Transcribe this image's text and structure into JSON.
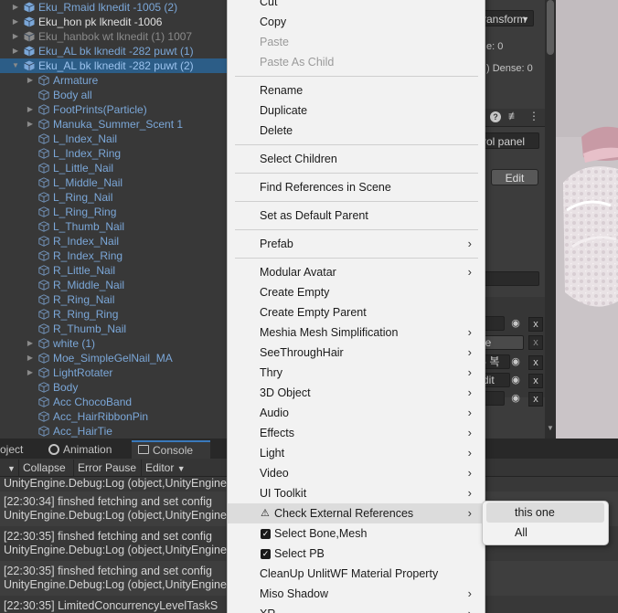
{
  "hierarchy": {
    "rows": [
      {
        "label": "Eku_Rmaid lknedit -1005 (2)",
        "type": "prefab",
        "depth": 0,
        "fold": "closed"
      },
      {
        "label": "Eku_hon pk lknedit -1006",
        "type": "white",
        "depth": 0,
        "fold": "closed"
      },
      {
        "label": "Eku_hanbok wt lknedit (1) 1007",
        "type": "faded",
        "depth": 0,
        "fold": "closed"
      },
      {
        "label": "Eku_AL bk  lknedit -282 puwt (1)",
        "type": "prefab",
        "depth": 0,
        "fold": "closed"
      },
      {
        "label": "Eku_AL bk  lknedit -282 puwt (2)",
        "type": "prefab",
        "depth": 0,
        "fold": "open",
        "selected": true
      },
      {
        "label": "Armature",
        "type": "prefab",
        "depth": 1,
        "fold": "closed"
      },
      {
        "label": "Body all",
        "type": "prefab",
        "depth": 1,
        "fold": "none"
      },
      {
        "label": "FootPrints(Particle)",
        "type": "prefab",
        "depth": 1,
        "fold": "closed"
      },
      {
        "label": "Manuka_Summer_Scent 1",
        "type": "prefab",
        "depth": 1,
        "fold": "closed"
      },
      {
        "label": "L_Index_Nail",
        "type": "prefab",
        "depth": 1,
        "fold": "none"
      },
      {
        "label": "L_Index_Ring",
        "type": "prefab",
        "depth": 1,
        "fold": "none"
      },
      {
        "label": "L_Little_Nail",
        "type": "prefab",
        "depth": 1,
        "fold": "none"
      },
      {
        "label": "L_Middle_Nail",
        "type": "prefab",
        "depth": 1,
        "fold": "none"
      },
      {
        "label": "L_Ring_Nail",
        "type": "prefab",
        "depth": 1,
        "fold": "none"
      },
      {
        "label": "L_Ring_Ring",
        "type": "prefab",
        "depth": 1,
        "fold": "none"
      },
      {
        "label": "L_Thumb_Nail",
        "type": "prefab",
        "depth": 1,
        "fold": "none"
      },
      {
        "label": "R_Index_Nail",
        "type": "prefab",
        "depth": 1,
        "fold": "none"
      },
      {
        "label": "R_Index_Ring",
        "type": "prefab",
        "depth": 1,
        "fold": "none"
      },
      {
        "label": "R_Little_Nail",
        "type": "prefab",
        "depth": 1,
        "fold": "none"
      },
      {
        "label": "R_Middle_Nail",
        "type": "prefab",
        "depth": 1,
        "fold": "none"
      },
      {
        "label": "R_Ring_Nail",
        "type": "prefab",
        "depth": 1,
        "fold": "none"
      },
      {
        "label": "R_Ring_Ring",
        "type": "prefab",
        "depth": 1,
        "fold": "none"
      },
      {
        "label": "R_Thumb_Nail",
        "type": "prefab",
        "depth": 1,
        "fold": "none"
      },
      {
        "label": "white (1)",
        "type": "prefab",
        "depth": 1,
        "fold": "closed"
      },
      {
        "label": "Moe_SimpleGelNail_MA",
        "type": "prefab",
        "depth": 1,
        "fold": "closed"
      },
      {
        "label": "LightRotater",
        "type": "prefab",
        "depth": 1,
        "fold": "closed"
      },
      {
        "label": "Body",
        "type": "prefab",
        "depth": 1,
        "fold": "none"
      },
      {
        "label": "Acc ChocoBand",
        "type": "prefab",
        "depth": 1,
        "fold": "none"
      },
      {
        "label": "Acc_HairRibbonPin",
        "type": "prefab",
        "depth": 1,
        "fold": "none"
      },
      {
        "label": "Acc_HairTie",
        "type": "prefab",
        "depth": 1,
        "fold": "none"
      }
    ]
  },
  "inspector": {
    "transform_dropdown": "ransform",
    "field_e": "e: 0",
    "field_dense": ") Dense: 0",
    "control_panel": "rol panel",
    "edit_button": "Edit",
    "field_le": "le",
    "field_korean": "- 복",
    "field_edit": "dit",
    "x_label": "x"
  },
  "console": {
    "tabs": [
      {
        "label": "oject",
        "icon": ""
      },
      {
        "label": "Animation",
        "icon": "animation-icon"
      },
      {
        "label": "Console",
        "icon": "console-icon",
        "active": true
      }
    ],
    "toolbar": {
      "collapse": "Collapse",
      "error_pause": "Error Pause",
      "editor": "Editor"
    },
    "entries": [
      {
        "line1": "",
        "line2": "UnityEngine.Debug:Log (object,UnityEngine"
      },
      {
        "line1": "[22:30:34] finshed fetching and set config",
        "line2": "UnityEngine.Debug:Log (object,UnityEngine"
      },
      {
        "line1": "[22:30:35] finshed fetching and set config",
        "line2": "UnityEngine.Debug:Log (object,UnityEngine"
      },
      {
        "line1": "[22:30:35] finshed fetching and set config",
        "line2": "UnityEngine.Debug:Log (object,UnityEngine"
      },
      {
        "line1": "[22:30:35] LimitedConcurrencyLevelTaskS",
        "line2": ""
      }
    ]
  },
  "menu": {
    "items": [
      {
        "label": "Cut",
        "kind": "item"
      },
      {
        "label": "Copy",
        "kind": "item"
      },
      {
        "label": "Paste",
        "kind": "item",
        "disabled": true
      },
      {
        "label": "Paste As Child",
        "kind": "item",
        "disabled": true
      },
      {
        "kind": "sep"
      },
      {
        "label": "Rename",
        "kind": "item"
      },
      {
        "label": "Duplicate",
        "kind": "item"
      },
      {
        "label": "Delete",
        "kind": "item"
      },
      {
        "kind": "sep"
      },
      {
        "label": "Select Children",
        "kind": "item"
      },
      {
        "kind": "sep"
      },
      {
        "label": "Find References in Scene",
        "kind": "item"
      },
      {
        "kind": "sep"
      },
      {
        "label": "Set as Default Parent",
        "kind": "item"
      },
      {
        "kind": "sep"
      },
      {
        "label": "Prefab",
        "kind": "item",
        "submenu": true
      },
      {
        "kind": "sep"
      },
      {
        "label": "Modular Avatar",
        "kind": "item",
        "submenu": true
      },
      {
        "label": "Create Empty",
        "kind": "item"
      },
      {
        "label": "Create Empty Parent",
        "kind": "item"
      },
      {
        "label": "Meshia Mesh Simplification",
        "kind": "item",
        "submenu": true
      },
      {
        "label": "SeeThroughHair",
        "kind": "item",
        "submenu": true
      },
      {
        "label": "Thry",
        "kind": "item",
        "submenu": true
      },
      {
        "label": "3D Object",
        "kind": "item",
        "submenu": true
      },
      {
        "label": "Audio",
        "kind": "item",
        "submenu": true
      },
      {
        "label": "Effects",
        "kind": "item",
        "submenu": true
      },
      {
        "label": "Light",
        "kind": "item",
        "submenu": true
      },
      {
        "label": "Video",
        "kind": "item",
        "submenu": true
      },
      {
        "label": "UI Toolkit",
        "kind": "item",
        "submenu": true
      },
      {
        "label": "Check External References",
        "kind": "item",
        "submenu": true,
        "warn": true,
        "hover": true
      },
      {
        "label": "Select Bone,Mesh",
        "kind": "item",
        "check": true
      },
      {
        "label": "Select PB",
        "kind": "item",
        "check": true
      },
      {
        "label": "CleanUp UnlitWF Material Property",
        "kind": "item"
      },
      {
        "label": "Miso Shadow",
        "kind": "item",
        "submenu": true
      },
      {
        "label": "XR",
        "kind": "item",
        "submenu": true
      }
    ],
    "warn_glyph": "⚠",
    "arrow_glyph": "›",
    "check_glyph": "✓"
  },
  "submenu": {
    "items": [
      {
        "label": "this one",
        "hover": true
      },
      {
        "label": "All"
      }
    ]
  },
  "colors": {
    "selection": "#2c5d87",
    "prefab_text": "#7ba7d8",
    "menu_bg": "#f2f2f2",
    "menu_hover": "#dcdcdc"
  }
}
